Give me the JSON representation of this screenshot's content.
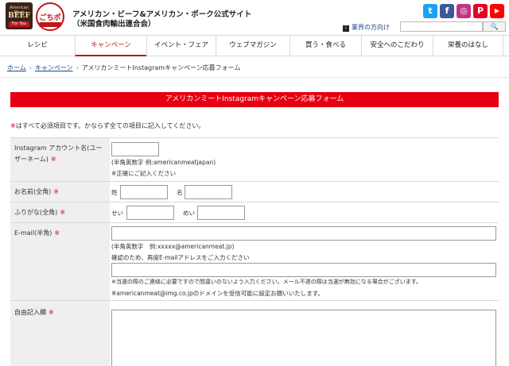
{
  "header": {
    "logo1": {
      "line1": "American Meat",
      "line2": "BEEF",
      "line3": "For You"
    },
    "logo2": {
      "text": "ごちポ"
    },
    "title_line1": "アメリカン・ビーフ&アメリカン・ポーク公式サイト",
    "title_line2": "（米国食肉輸出連合会）",
    "social": [
      {
        "icon": "twitter-icon",
        "glyph": "t"
      },
      {
        "icon": "facebook-icon",
        "glyph": "f"
      },
      {
        "icon": "instagram-icon",
        "glyph": "◎"
      },
      {
        "icon": "pinterest-icon",
        "glyph": "P"
      },
      {
        "icon": "youtube-icon",
        "glyph": "▶"
      }
    ],
    "industry_link": "業界の方向け",
    "search_button": "🔍"
  },
  "nav": {
    "items": [
      "レシピ",
      "キャンペーン",
      "イベント・フェア",
      "ウェブマガジン",
      "買う・食べる",
      "安全へのこだわり",
      "栄養のはなし"
    ],
    "active": "キャンペーン"
  },
  "breadcrumb": {
    "home": "ホーム",
    "campaign": "キャンペーン",
    "current": "アメリカンミートInstagramキャンペーン応募フォーム"
  },
  "form": {
    "title": "アメリカンミートInstagramキャンペーン応募フォーム",
    "required_note_mark": "※",
    "required_note_text": "はすべて必須項目です。かならず全ての項目に記入してください。",
    "required_mark": "※",
    "instagram": {
      "label": "Instagram アカウント名(ユーザーネーム)",
      "hint1": "(半角英数字 例:americanmeatjapan)",
      "hint2": "※正確にご記入ください"
    },
    "name": {
      "label": "お名前(全角)",
      "sei": "姓",
      "mei": "名"
    },
    "kana": {
      "label": "ふりがな(全角)",
      "sei": "せい",
      "mei": "めい"
    },
    "email": {
      "label": "E-mail(半角)",
      "hint1": "(半角英数字　例:xxxxx@americanmeat.jp)",
      "hint2": "確認のため、再度E-mailアドレスをご入力ください",
      "note1": "※当選の際のご連絡に必要ですので間違いのないよう入力ください。メール不達の際は当選が無効になる場合がございます。",
      "note2": "※americanmeat@img.co.jpのドメインを受信可能に設定お願いいたします。"
    },
    "free": {
      "label": "自由記入欄"
    }
  }
}
